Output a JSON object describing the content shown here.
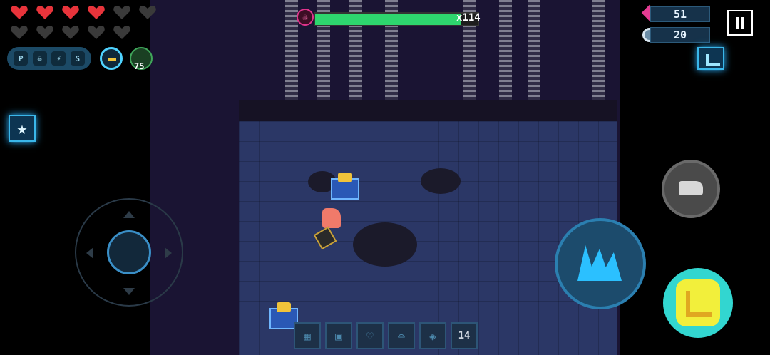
{
  "hud": {
    "health": {
      "full": 4,
      "empty": 7
    },
    "buffs": [
      "P",
      "☠",
      "⚡",
      "S"
    ],
    "companion_count": "75"
  },
  "boss": {
    "health_fraction": 0.9,
    "multiplier": "x114"
  },
  "currency": {
    "gems": "51",
    "parts": "20"
  },
  "inventory": {
    "ammo_count": "14"
  },
  "colors": {
    "heart": "#e8343b",
    "boss_bar": "#2ed66e",
    "accent": "#2bb3ff",
    "skill": "#f2ef3b"
  },
  "icons": {
    "gem": "pink-gem-icon",
    "parts": "gear-parts-icon",
    "pause": "pause-icon",
    "minimap": "minimap-icon",
    "star": "star-skill-icon",
    "swap": "swap-weapon-icon",
    "attack": "attack-claw-icon",
    "skill": "skill-icon"
  }
}
